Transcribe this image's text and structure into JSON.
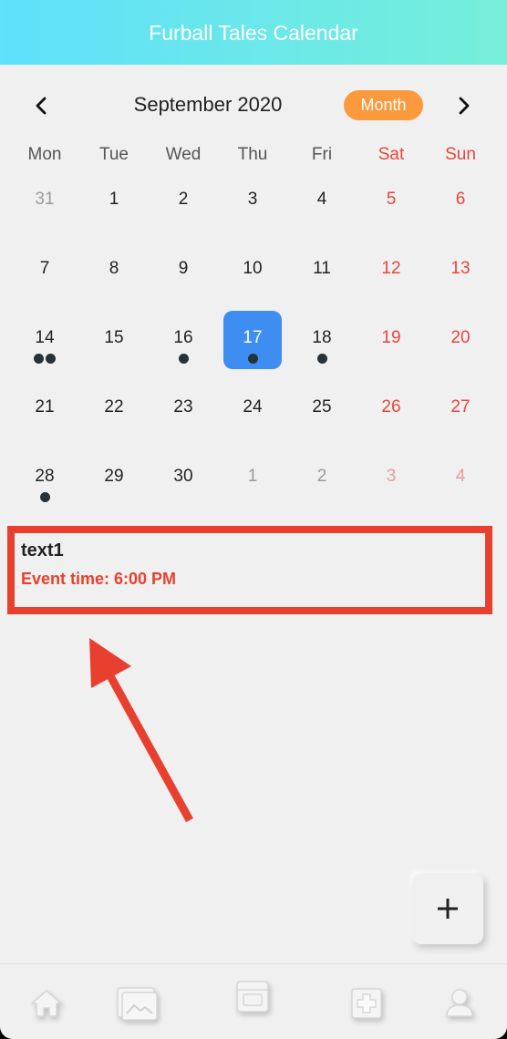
{
  "header": {
    "title": "Furball Tales Calendar"
  },
  "calendar": {
    "month_label": "September 2020",
    "view_label": "Month",
    "weekdays": [
      "Mon",
      "Tue",
      "Wed",
      "Thu",
      "Fri",
      "Sat",
      "Sun"
    ],
    "days": [
      {
        "label": "31",
        "other": true,
        "dots": 0
      },
      {
        "label": "1",
        "dots": 0
      },
      {
        "label": "2",
        "dots": 0
      },
      {
        "label": "3",
        "dots": 0
      },
      {
        "label": "4",
        "dots": 0
      },
      {
        "label": "5",
        "dots": 0
      },
      {
        "label": "6",
        "dots": 0
      },
      {
        "label": "7",
        "dots": 0
      },
      {
        "label": "8",
        "dots": 0
      },
      {
        "label": "9",
        "dots": 0
      },
      {
        "label": "10",
        "dots": 0
      },
      {
        "label": "11",
        "dots": 0
      },
      {
        "label": "12",
        "dots": 0
      },
      {
        "label": "13",
        "dots": 0
      },
      {
        "label": "14",
        "dots": 2
      },
      {
        "label": "15",
        "dots": 0
      },
      {
        "label": "16",
        "dots": 1
      },
      {
        "label": "17",
        "selected": true,
        "dots": 1
      },
      {
        "label": "18",
        "dots": 1
      },
      {
        "label": "19",
        "dots": 0
      },
      {
        "label": "20",
        "dots": 0
      },
      {
        "label": "21",
        "dots": 0
      },
      {
        "label": "22",
        "dots": 0
      },
      {
        "label": "23",
        "dots": 0
      },
      {
        "label": "24",
        "dots": 0
      },
      {
        "label": "25",
        "dots": 0
      },
      {
        "label": "26",
        "dots": 0
      },
      {
        "label": "27",
        "dots": 0
      },
      {
        "label": "28",
        "dots": 1
      },
      {
        "label": "29",
        "dots": 0
      },
      {
        "label": "30",
        "dots": 0
      },
      {
        "label": "1",
        "other": true,
        "dots": 0
      },
      {
        "label": "2",
        "other": true,
        "dots": 0
      },
      {
        "label": "3",
        "other": true,
        "dots": 0
      },
      {
        "label": "4",
        "other": true,
        "dots": 0
      }
    ]
  },
  "event": {
    "title": "text1",
    "time": "Event time: 6:00 PM"
  },
  "tabs": [
    {
      "icon": "home-icon"
    },
    {
      "icon": "gallery-icon"
    },
    {
      "icon": "calendar-icon"
    },
    {
      "icon": "medical-icon"
    },
    {
      "icon": "profile-icon"
    }
  ],
  "colors": {
    "header_gradient_start": "#5fe0fb",
    "header_gradient_end": "#76efd9",
    "month_pill": "#fb9a3c",
    "selected_day": "#3d8ef0",
    "weekend_text": "#e8463a",
    "highlight_box": "#e8402e"
  }
}
